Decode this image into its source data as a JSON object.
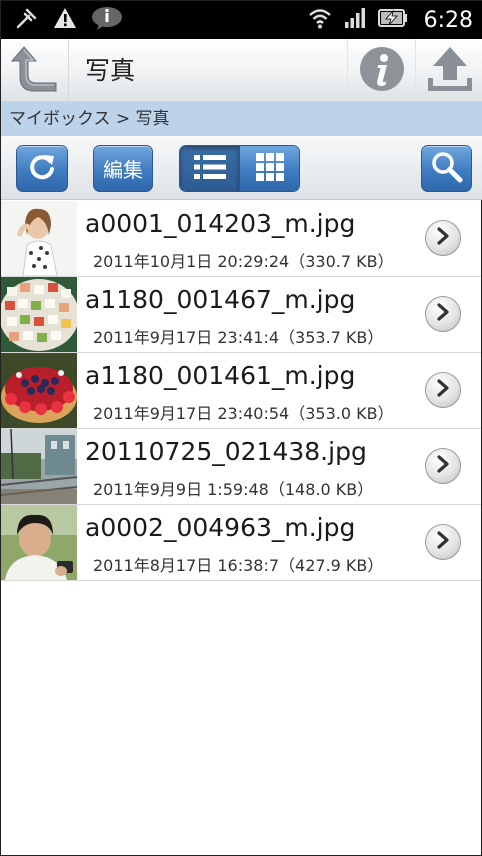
{
  "status_bar": {
    "time": "6:28",
    "icons": [
      "usb-debug-icon",
      "warning-icon",
      "chat-bubble-icon",
      "wifi-icon",
      "signal-icon",
      "battery-charging-icon"
    ]
  },
  "title_bar": {
    "title": "写真",
    "icons": [
      "back-arrow-icon",
      "info-icon",
      "upload-icon"
    ]
  },
  "breadcrumb": {
    "text": "マイボックス > 写真"
  },
  "toolbar": {
    "edit_label": "編集",
    "icons": [
      "refresh-icon",
      "list-view-icon",
      "grid-view-icon",
      "search-icon"
    ]
  },
  "files": [
    {
      "name": "a0001_014203_m.jpg",
      "meta": "2011年10月1日 20:29:24（330.7 KB）",
      "thumbnail": "woman-portrait"
    },
    {
      "name": "a1180_001467_m.jpg",
      "meta": "2011年9月17日 23:41:4（353.7 KB）",
      "thumbnail": "sushi-platter"
    },
    {
      "name": "a1180_001461_m.jpg",
      "meta": "2011年9月17日 23:40:54（353.0 KB）",
      "thumbnail": "berry-cake"
    },
    {
      "name": "20110725_021438.jpg",
      "meta": "2011年9月9日 1:59:48（148.0 KB）",
      "thumbnail": "railway-scene"
    },
    {
      "name": "a0002_004963_m.jpg",
      "meta": "2011年8月17日 16:38:7（427.9 KB）",
      "thumbnail": "man-with-phone"
    }
  ],
  "colors": {
    "button_blue": "#3f7cc1",
    "breadcrumb_bg": "#bcd3ea",
    "status_bar_bg": "#000000"
  }
}
